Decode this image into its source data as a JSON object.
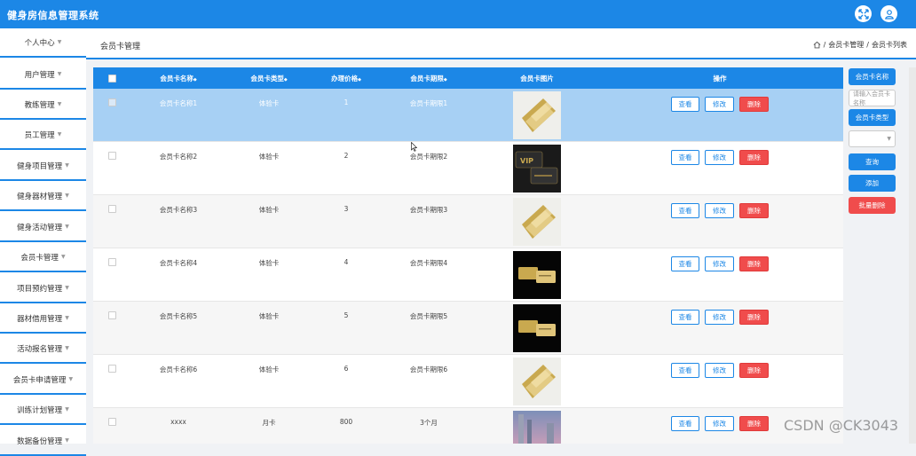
{
  "app": {
    "title": "健身房信息管理系统"
  },
  "topbar": {
    "fullscreen_icon": "expand-icon",
    "user_icon": "user-icon"
  },
  "sidebar": {
    "items": [
      {
        "label": "个人中心"
      },
      {
        "label": "用户管理"
      },
      {
        "label": "教练管理"
      },
      {
        "label": "员工管理"
      },
      {
        "label": "健身项目管理"
      },
      {
        "label": "健身器材管理"
      },
      {
        "label": "健身活动管理"
      },
      {
        "label": "会员卡管理"
      },
      {
        "label": "项目预约管理"
      },
      {
        "label": "器材借用管理"
      },
      {
        "label": "活动报名管理"
      },
      {
        "label": "会员卡申请管理"
      },
      {
        "label": "训练计划管理"
      },
      {
        "label": "数据备份管理"
      }
    ]
  },
  "header": {
    "page_title": "会员卡管理",
    "breadcrumb": [
      "会员卡管理",
      "会员卡列表"
    ],
    "separator": "/"
  },
  "table": {
    "columns": [
      "会员卡名称",
      "会员卡类型",
      "办理价格",
      "会员卡期限",
      "会员卡图片",
      "操作"
    ],
    "sort_mark": "◆",
    "rows": [
      {
        "name": "会员卡名称1",
        "type": "体验卡",
        "price": "1",
        "term": "会员卡期限1",
        "image": "gold-card"
      },
      {
        "name": "会员卡名称2",
        "type": "体验卡",
        "price": "2",
        "term": "会员卡期限2",
        "image": "vip-black-card"
      },
      {
        "name": "会员卡名称3",
        "type": "体验卡",
        "price": "3",
        "term": "会员卡期限3",
        "image": "gold-card"
      },
      {
        "name": "会员卡名称4",
        "type": "体验卡",
        "price": "4",
        "term": "会员卡期限4",
        "image": "gold-on-black-card"
      },
      {
        "name": "会员卡名称5",
        "type": "体验卡",
        "price": "5",
        "term": "会员卡期限5",
        "image": "gold-on-black-card"
      },
      {
        "name": "会员卡名称6",
        "type": "体验卡",
        "price": "6",
        "term": "会员卡期限6",
        "image": "gold-card"
      },
      {
        "name": "xxxx",
        "type": "月卡",
        "price": "800",
        "term": "3个月",
        "image": "city-photo"
      }
    ],
    "actions": {
      "view": "查看",
      "edit": "修改",
      "delete": "删除"
    }
  },
  "search_panel": {
    "name_label": "会员卡名称",
    "name_placeholder": "请输入会员卡名称",
    "type_label": "会员卡类型",
    "type_value": "",
    "query_button": "查询",
    "add_button": "添加",
    "batch_delete_button": "批量删除"
  },
  "watermark": "CSDN @CK3043",
  "colors": {
    "primary": "#1c87e6",
    "danger": "#f04c4c",
    "selected_row": "#a7d0f4"
  }
}
